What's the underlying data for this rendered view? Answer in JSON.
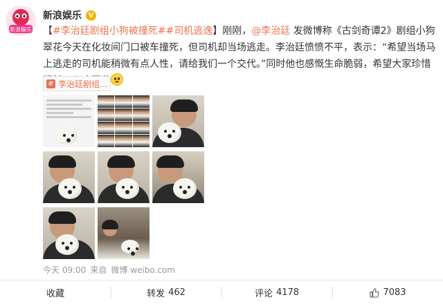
{
  "account": {
    "avatar_text": "新浪娱乐",
    "name": "新浪娱乐",
    "verified_mark": "V"
  },
  "post": {
    "topic_1": "#李治廷剧组小狗被撞死#",
    "topic_2": "#司机逃逸",
    "bracket_close": "】",
    "text_1": "刚刚，",
    "mention": "@李治廷",
    "text_2": " 发微博称《古剑奇谭2》剧组小狗翠花今天在化妆间门口被车撞死，但司机却当场逃走。李治廷愤愤不平，表示：“希望当场马上逃走的司机能稍微有点人性，请给我们一个交代。”同时他也感慨生命脆弱，希望大家珍惜眼前。心疼翠花",
    "bracket_open": "【"
  },
  "topic_card": {
    "icon": "#",
    "label": "李治廷剧组..."
  },
  "photos": [
    {
      "type": "document"
    },
    {
      "type": "collage"
    },
    {
      "type": "man-with-dog"
    },
    {
      "type": "man-with-dog"
    },
    {
      "type": "man-with-dog"
    },
    {
      "type": "man-with-dog"
    },
    {
      "type": "man-with-dog"
    },
    {
      "type": "room-scene"
    }
  ],
  "meta": {
    "time": "今天 09:00",
    "source_prefix": "来自",
    "source": "微博 weibo.com"
  },
  "actions": {
    "favorite": "收藏",
    "repost_label": "转发",
    "repost_count": "462",
    "comment_label": "评论",
    "comment_count": "4178",
    "like_count": "7083"
  },
  "colors": {
    "link": "#eb7350",
    "verified": "#f3b200"
  }
}
